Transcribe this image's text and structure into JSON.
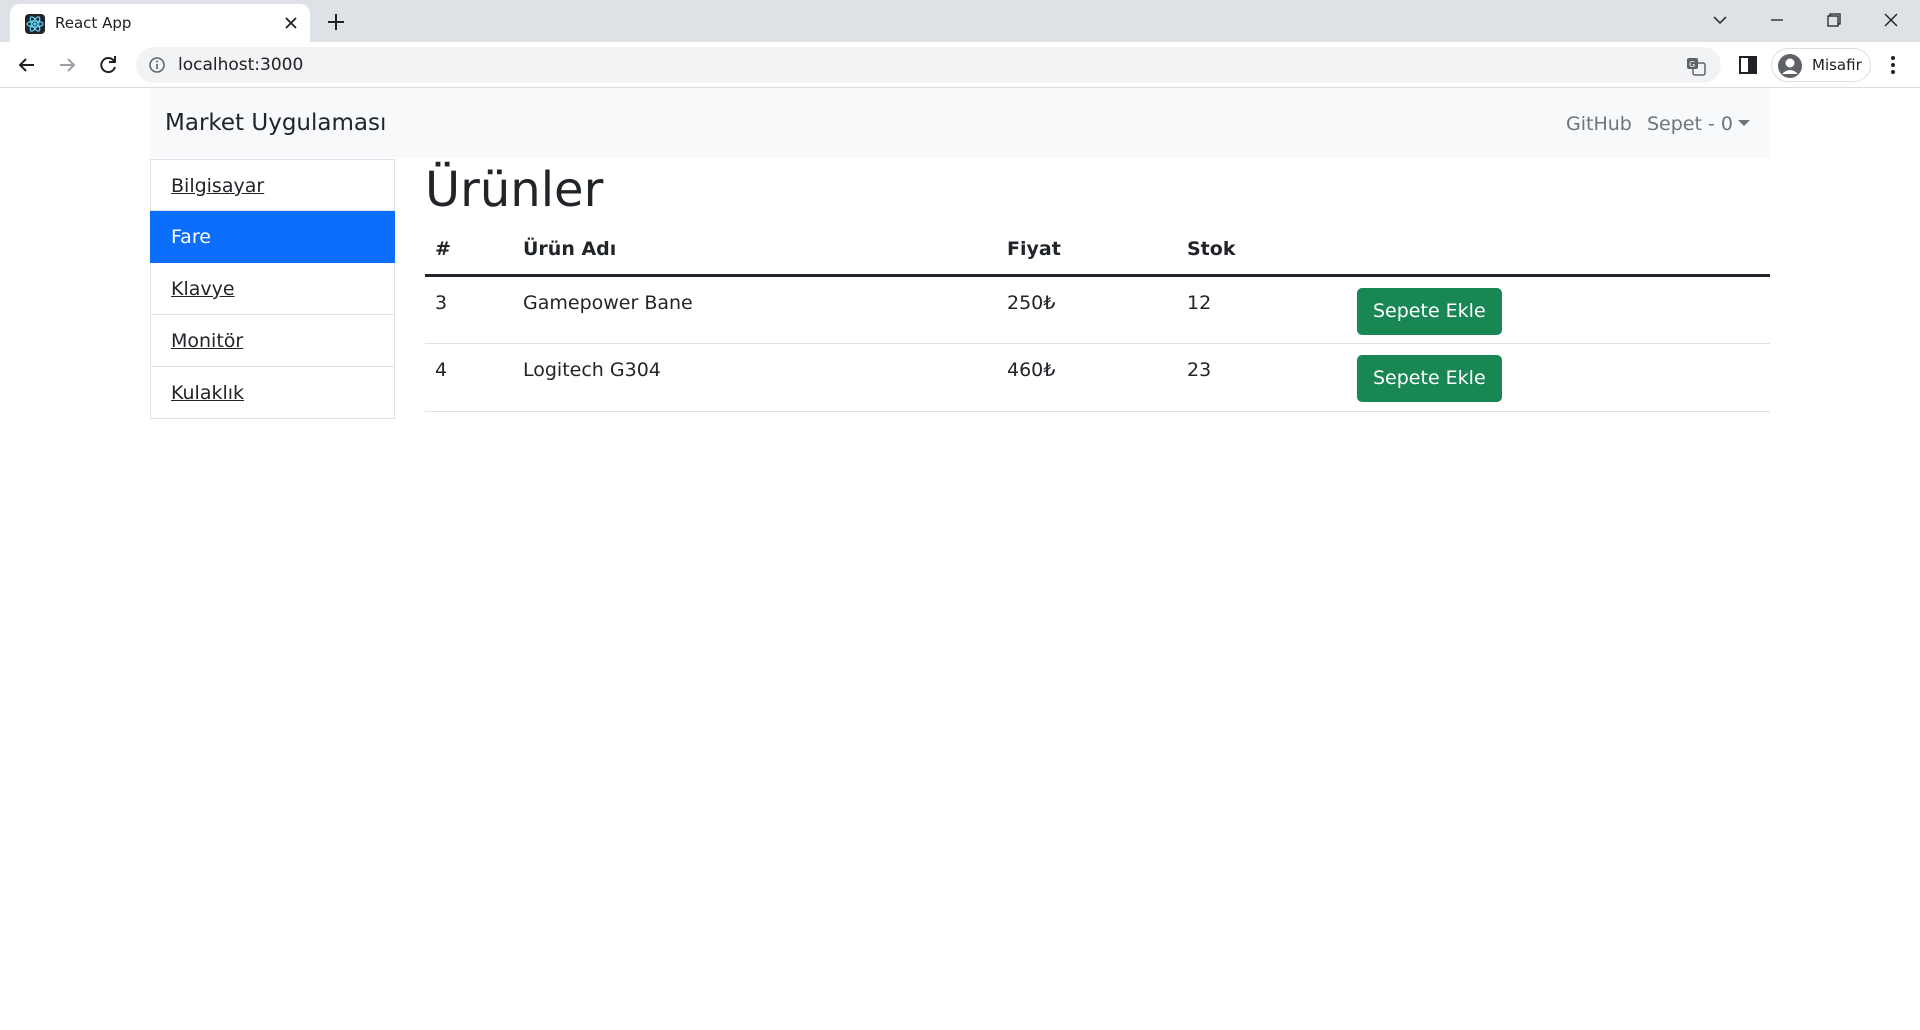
{
  "browser": {
    "tab_title": "React App",
    "url": "localhost:3000",
    "profile_name": "Misafir"
  },
  "navbar": {
    "brand": "Market Uygulaması",
    "github_label": "GitHub",
    "cart_label": "Sepet - 0"
  },
  "categories": [
    {
      "label": "Bilgisayar"
    },
    {
      "label": "Fare",
      "active": true
    },
    {
      "label": "Klavye"
    },
    {
      "label": "Monitör"
    },
    {
      "label": "Kulaklık"
    }
  ],
  "main": {
    "title": "Ürünler",
    "columns": [
      "#",
      "Ürün Adı",
      "Fiyat",
      "Stok",
      ""
    ],
    "rows": [
      {
        "id": "3",
        "name": "Gamepower Bane",
        "price": "250₺",
        "stock": "12",
        "action": "Sepete Ekle"
      },
      {
        "id": "4",
        "name": "Logitech G304",
        "price": "460₺",
        "stock": "23",
        "action": "Sepete Ekle"
      }
    ]
  },
  "colors": {
    "active": "#0d6efd",
    "success": "#198754",
    "navbar_bg": "#f8f9fa"
  }
}
